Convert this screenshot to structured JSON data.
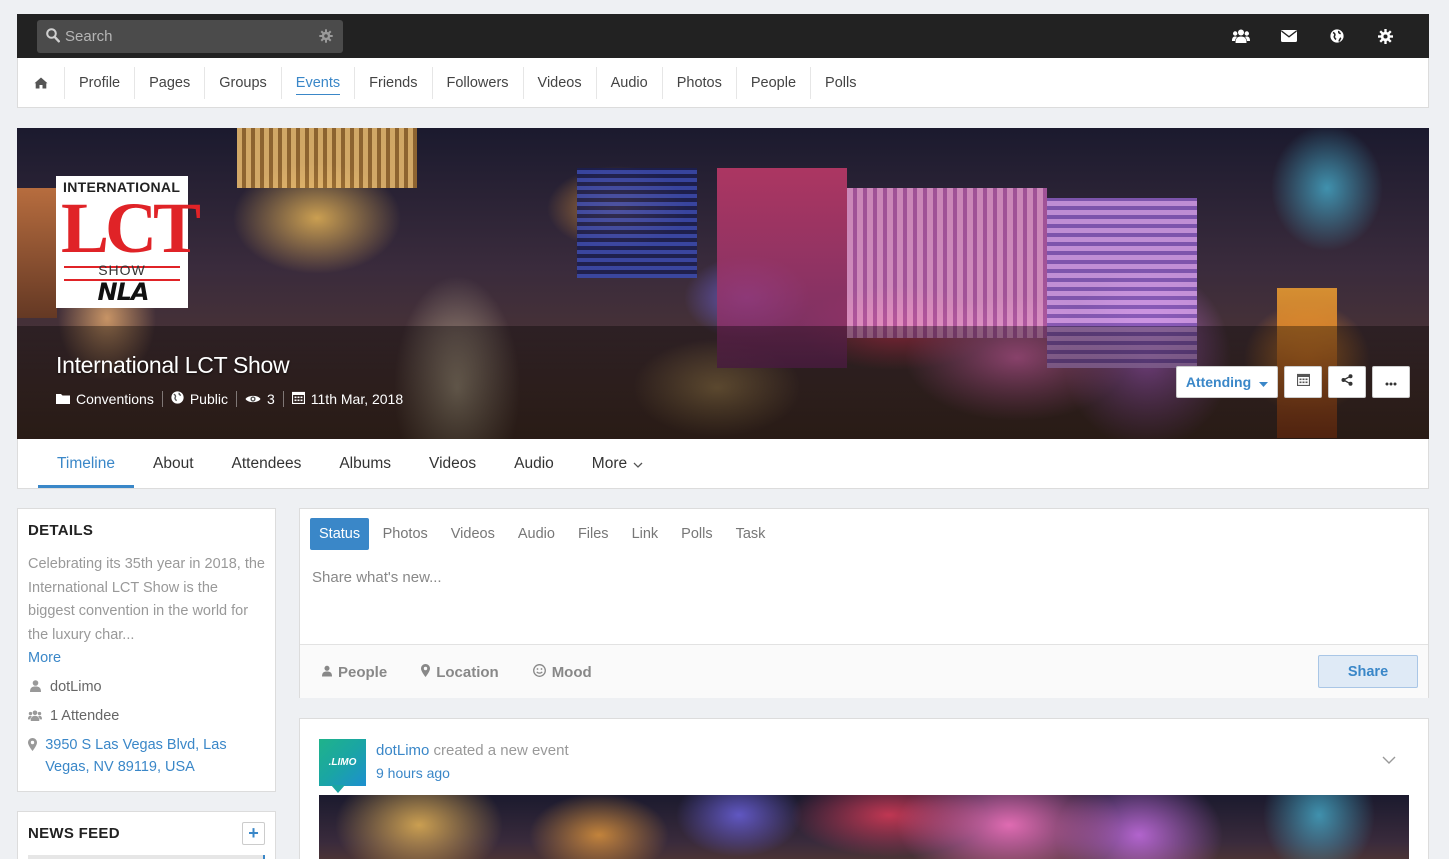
{
  "search": {
    "placeholder": "Search"
  },
  "topbar": {
    "icons": [
      "friends-icon",
      "messages-icon",
      "globe-icon",
      "settings-gear-icon"
    ]
  },
  "main_nav": {
    "items": [
      {
        "label": "Profile"
      },
      {
        "label": "Pages"
      },
      {
        "label": "Groups"
      },
      {
        "label": "Events",
        "active": true
      },
      {
        "label": "Friends"
      },
      {
        "label": "Followers"
      },
      {
        "label": "Videos"
      },
      {
        "label": "Audio"
      },
      {
        "label": "Photos"
      },
      {
        "label": "People"
      },
      {
        "label": "Polls"
      }
    ]
  },
  "cover": {
    "logo": {
      "line1": "INTERNATIONAL",
      "line2": "LCT",
      "line3": "SHOW",
      "line4": "NLA"
    },
    "title": "International LCT Show",
    "category": "Conventions",
    "privacy": "Public",
    "views": "3",
    "date": "11th Mar, 2018",
    "attending_label": "Attending"
  },
  "sub_nav": {
    "items": [
      {
        "label": "Timeline",
        "active": true
      },
      {
        "label": "About"
      },
      {
        "label": "Attendees"
      },
      {
        "label": "Albums"
      },
      {
        "label": "Videos"
      },
      {
        "label": "Audio"
      },
      {
        "label": "More"
      }
    ]
  },
  "details": {
    "heading": "DETAILS",
    "description": "Celebrating its 35th year in 2018, the International LCT Show is the biggest convention in the world for the luxury char...",
    "more_label": "More",
    "owner": "dotLimo",
    "attendees": "1 Attendee",
    "address": "3950 S Las Vegas Blvd, Las Vegas, NV 89119, USA"
  },
  "news_feed": {
    "heading": "NEWS FEED",
    "add_label": "+"
  },
  "composer": {
    "tabs": [
      {
        "label": "Status",
        "active": true
      },
      {
        "label": "Photos"
      },
      {
        "label": "Videos"
      },
      {
        "label": "Audio"
      },
      {
        "label": "Files"
      },
      {
        "label": "Link"
      },
      {
        "label": "Polls"
      },
      {
        "label": "Task"
      }
    ],
    "placeholder": "Share what's new...",
    "options": {
      "people": "People",
      "location": "Location",
      "mood": "Mood"
    },
    "share_label": "Share"
  },
  "post": {
    "avatar_text": ".LIMO",
    "author": "dotLimo",
    "action": "created a new event",
    "time": "9 hours ago"
  },
  "colors": {
    "accent": "#3a87c8",
    "topbar": "#222222",
    "page_bg": "#eef0f3"
  }
}
